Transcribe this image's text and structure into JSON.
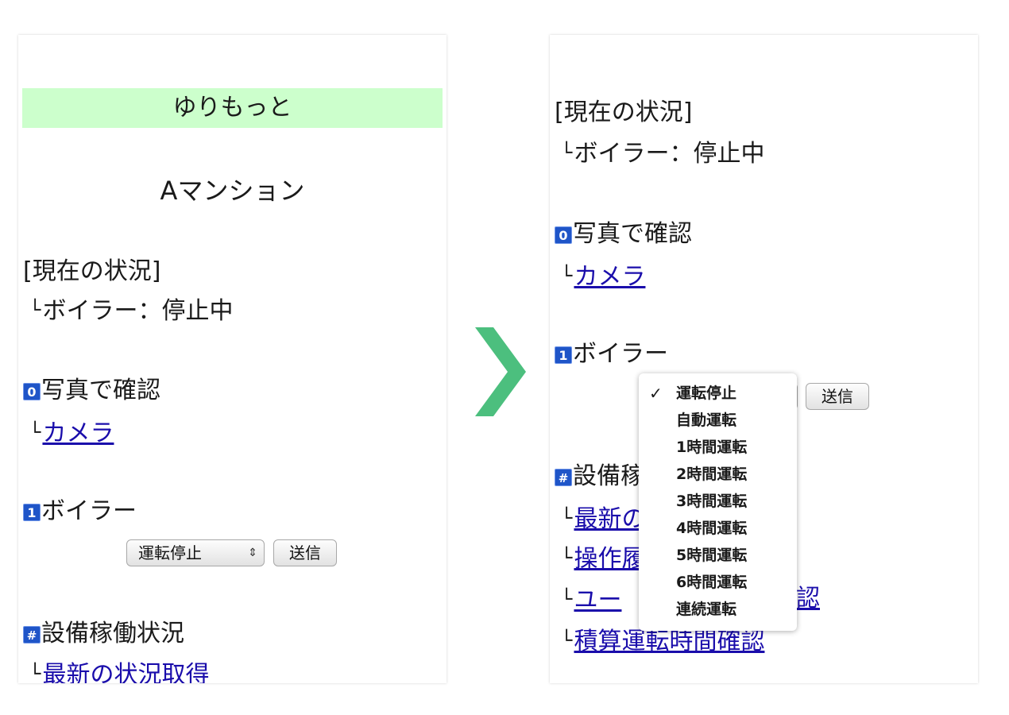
{
  "left_panel": {
    "header_title": "ゆりもっと",
    "building_name": "Aマンション",
    "status_heading": "[現在の状況]",
    "status_line": "ボイラー：停止中",
    "corner_mark": "└",
    "photo_key": "0",
    "photo_heading": "写真で確認",
    "camera_link": "カメラ",
    "boiler_key": "1",
    "boiler_heading": "ボイラー",
    "boiler_select_value": "運転停止",
    "select_arrows": "⇕",
    "send_button": "送信",
    "equipment_key": "#",
    "equipment_heading": "設備稼働状況",
    "latest_link": "最新の状況取得"
  },
  "right_panel": {
    "status_heading": "[現在の状況]",
    "status_line": "ボイラー：停止中",
    "corner_mark": "└",
    "photo_key": "0",
    "photo_heading": "写真で確認",
    "camera_link": "カメラ",
    "boiler_key": "1",
    "boiler_heading": "ボイラー",
    "send_button": "送信",
    "equipment_key": "#",
    "equipment_heading": "設備稼",
    "links": [
      "最新の",
      "操作履",
      "ユー",
      "認",
      "積算運転時間確認"
    ]
  },
  "dropdown": {
    "check_mark": "✓",
    "selected_index": 0,
    "options": [
      "運転停止",
      "自動運転",
      "1時間運転",
      "2時間運転",
      "3時間運転",
      "4時間運転",
      "5時間運転",
      "6時間運転",
      "連続運転"
    ]
  },
  "colors": {
    "banner": "#ccffcc",
    "link": "#1a0dab",
    "key_icon": "#1f55c8",
    "transition_arrow": "#4cbf7e"
  },
  "icons": {
    "transition": "chevron-right-icon"
  }
}
